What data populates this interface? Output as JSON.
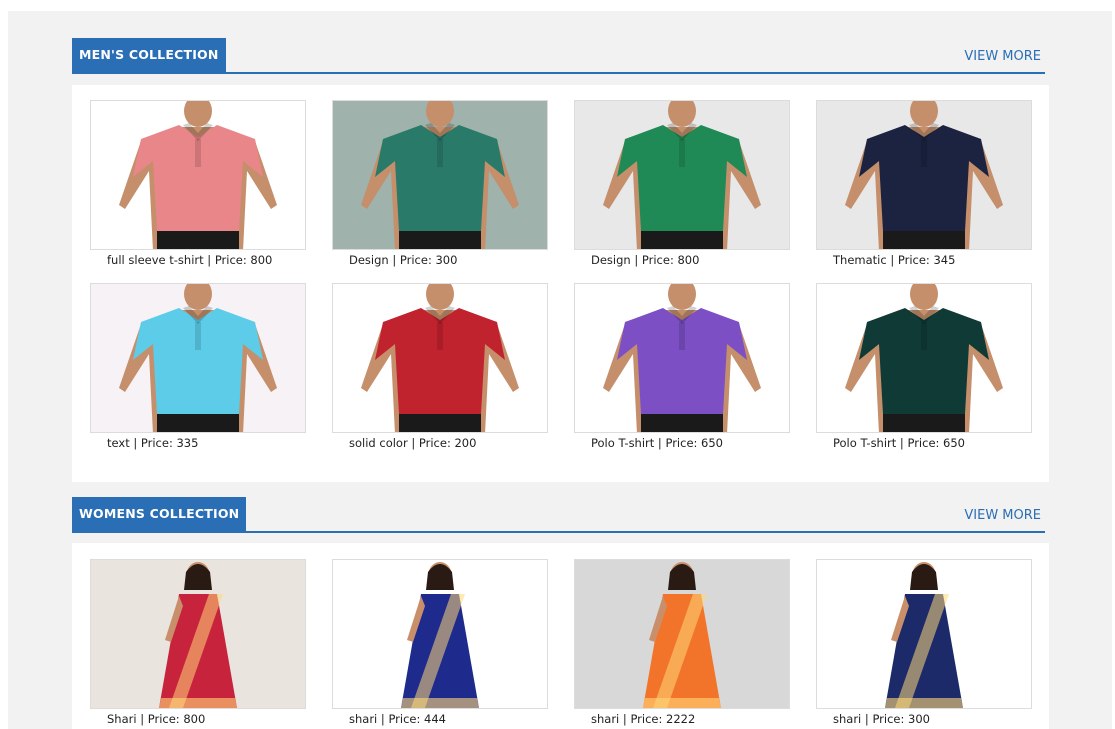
{
  "mens": {
    "title": "MEN'S COLLECTION",
    "view_more": "VIEW MORE",
    "products": [
      {
        "name": "full sleeve t-shirt",
        "price_text": "Price: 800",
        "shirt": "#e8868a",
        "bg": "#ffffff",
        "icon": "pink-polo-image"
      },
      {
        "name": "Design",
        "price_text": "Price: 300",
        "shirt": "#2a7a6a",
        "bg": "#9fb2ab",
        "icon": "teal-polo-image"
      },
      {
        "name": "Design",
        "price_text": "Price: 800",
        "shirt": "#1f8a55",
        "bg": "#e8e8e8",
        "icon": "green-polo-image"
      },
      {
        "name": "Thematic",
        "price_text": "Price: 345",
        "shirt": "#1b2340",
        "bg": "#e8e8e8",
        "icon": "navy-polo-image"
      },
      {
        "name": "text",
        "price_text": "Price: 335",
        "shirt": "#5ccce8",
        "bg": "#f7f2f5",
        "icon": "sky-blue-polo-image"
      },
      {
        "name": "solid color",
        "price_text": "Price: 200",
        "shirt": "#c0222e",
        "bg": "#ffffff",
        "icon": "red-black-polo-image"
      },
      {
        "name": "Polo T-shirt",
        "price_text": "Price: 650",
        "shirt": "#7c4fc4",
        "bg": "#ffffff",
        "icon": "purple-polo-image"
      },
      {
        "name": "Polo T-shirt",
        "price_text": "Price: 650",
        "shirt": "#0f3a36",
        "bg": "#ffffff",
        "icon": "dark-green-polo-image"
      }
    ]
  },
  "womens": {
    "title": "WOMENS COLLECTION",
    "view_more": "VIEW MORE",
    "products": [
      {
        "name": "Shari",
        "price_text": "Price: 800",
        "shirt": "#c8233c",
        "bg": "#e9e4dd",
        "icon": "red-saree-image"
      },
      {
        "name": "shari",
        "price_text": "Price: 444",
        "shirt": "#1e2a8c",
        "bg": "#ffffff",
        "icon": "blue-saree-image"
      },
      {
        "name": "shari",
        "price_text": "Price: 2222",
        "shirt": "#f2742a",
        "bg": "#d8d8d8",
        "icon": "orange-saree-image"
      },
      {
        "name": "shari",
        "price_text": "Price: 300",
        "shirt": "#1c2a6a",
        "bg": "#ffffff",
        "icon": "navy-saree-image"
      }
    ]
  },
  "colors": {
    "accent": "#2a6fb5",
    "page_bg": "#f2f2f2"
  }
}
